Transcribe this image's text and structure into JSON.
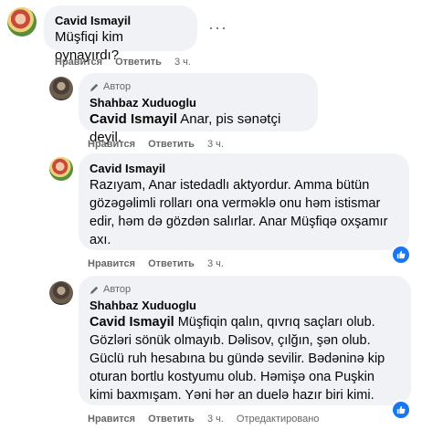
{
  "comments": [
    {
      "author": "Cavid Ismayil",
      "text": "Müşfiqi kim oynayırdı?",
      "actions": {
        "like": "Нравится",
        "reply": "Ответить",
        "time": "3 ч."
      }
    },
    {
      "badge": "Автор",
      "author": "Shahbaz Xuduoglu",
      "mention": "Cavid Ismayil",
      "text": " Anar, pis sənətçi deyil.",
      "actions": {
        "like": "Нравится",
        "reply": "Ответить",
        "time": "3 ч."
      }
    },
    {
      "author": "Cavid Ismayil",
      "text": "Razıyam, Anar istedadlı aktyordur. Amma bütün gözəgəlimli rolları ona verməklə onu həm istismar edir, həm də gözdən salırlar. Anar Müşfiqə oxşamır axı.",
      "actions": {
        "like": "Нравится",
        "reply": "Ответить",
        "time": "3 ч."
      },
      "reaction": "like"
    },
    {
      "badge": "Автор",
      "author": "Shahbaz Xuduoglu",
      "mention": "Cavid Ismayil",
      "text": " Müşfiqin qalın, qıvrıq saçları olub. Gözləri sönük olmayıb. Dəlisov, çılğın, şən olub. Güclü ruh hesabına bu gündə sevilir. Bədəninə kip oturan bortlu kostyumu olub. Həmişə ona Puşkin kimi baxmışam. Yəni hər an duelə hazır biri kimi.",
      "actions": {
        "like": "Нравится",
        "reply": "Ответить",
        "time": "3 ч.",
        "edited": "Отредактировано"
      },
      "reaction": "like"
    }
  ]
}
